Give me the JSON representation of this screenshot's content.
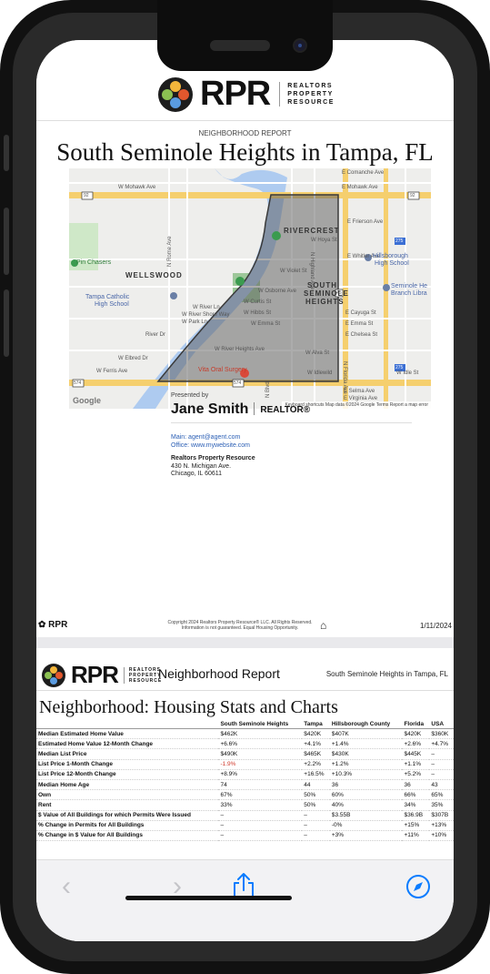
{
  "page1": {
    "logo": {
      "name": "RPR",
      "sub": [
        "REALTORS",
        "PROPERTY",
        "RESOURCE"
      ]
    },
    "report_type": "NEIGHBORHOOD REPORT",
    "title": "South Seminole Heights in Tampa, FL",
    "map": {
      "labels": {
        "mohawk": "W Mohawk Ave",
        "comanche": "E Comanche Ave",
        "emohawk": "E Mohawk Ave",
        "frierson": "E Frierson Ave",
        "hoya": "W Hoya St",
        "whitler": "E Whitler Ave",
        "rivercrest": "RIVERCREST",
        "pin": "Pin Chasers",
        "wellswood": "WELLSWOOD",
        "tampacath1": "Tampa Catholic",
        "tampacath2": "High School",
        "violet": "W Violet St",
        "ssh1": "SOUTH",
        "ssh2": "SEMINOLE",
        "ssh3": "HEIGHTS",
        "hills1": "Hillsborough",
        "hills2": "High School",
        "semlib1": "Seminole He",
        "semlib2": "Branch Libra",
        "osborne": "W Osborne Ave",
        "curtis": "W Curtis St",
        "hibbs": "W Hibbs St",
        "emma": "W Emma St",
        "cayuga": "E Cayuga St",
        "eemma": "E Emma St",
        "chelsea": "E Chelsea St",
        "riverhts": "W River Heights Ave",
        "alva": "W Alva St",
        "idlewild": "W Idlewild",
        "idlest": "W Idle St",
        "elbred": "W Elbred Dr",
        "ferris": "W Ferris Ave",
        "oral": "Vita Oral Surgery",
        "highland": "N Highland Ave",
        "nrome": "N Rome Ave",
        "nblvd": "N Blvd",
        "nflorida": "N Florida Ave",
        "eselma": "E Selma Ave",
        "evirginia": "E Virginia Ave",
        "riverdr": "River Dr",
        "parkln": "W Park Ln",
        "shoreway": "W River Shore Way",
        "riverln": "W River Ln",
        "google": "Google",
        "attribution": "Keyboard shortcuts   Map data ©2024 Google   Terms   Report a map error",
        "shield_92a": "92",
        "shield_92b": "92",
        "shield_275a": "275",
        "shield_275b": "275",
        "shield_574a": "574",
        "shield_574b": "574",
        "shield_45": "45"
      }
    },
    "presented_by": "Presented by",
    "agent_name": "Jane Smith",
    "agent_credential": "REALTOR®",
    "contact_main": "Main: agent@agent.com",
    "contact_office": "Office: www.mywebsite.com",
    "company": "Realtors Property Resource",
    "address1": "430 N. Michigan Ave.",
    "address2": "Chicago, IL 60611",
    "footer": {
      "brand": "RPR",
      "copyright1": "Copyright 2024 Realtors Property Resource® LLC. All Rights Reserved.",
      "copyright2": "Information is not guaranteed. Equal Housing Opportunity.",
      "date": "1/11/2024"
    }
  },
  "page2": {
    "header_title": "Neighborhood Report",
    "location": "South Seminole Heights in Tampa, FL",
    "section_title": "Neighborhood: Housing Stats and Charts",
    "columns": [
      "",
      "South Seminole Heights",
      "Tampa",
      "Hillsborough County",
      "Florida",
      "USA"
    ],
    "rows": [
      [
        "Median Estimated Home Value",
        "$462K",
        "$420K",
        "$407K",
        "$420K",
        "$360K"
      ],
      [
        "Estimated Home Value 12-Month Change",
        "+6.6%",
        "+4.1%",
        "+1.4%",
        "+2.6%",
        "+4.7%"
      ],
      [
        "Median List Price",
        "$490K",
        "$465K",
        "$430K",
        "$445K",
        "–"
      ],
      [
        "List Price 1-Month Change",
        "-1.9%",
        "+2.2%",
        "+1.2%",
        "+1.1%",
        "–"
      ],
      [
        "List Price 12-Month Change",
        "+8.9%",
        "+16.5%",
        "+10.3%",
        "+5.2%",
        "–"
      ],
      [
        "Median Home Age",
        "74",
        "44",
        "36",
        "36",
        "43"
      ],
      [
        "Own",
        "67%",
        "50%",
        "60%",
        "66%",
        "65%"
      ],
      [
        "Rent",
        "33%",
        "50%",
        "40%",
        "34%",
        "35%"
      ],
      [
        "$ Value of All Buildings for which Permits Were Issued",
        "–",
        "–",
        "$3.55B",
        "$36.9B",
        "$307B"
      ],
      [
        "% Change in Permits for All Buildings",
        "–",
        "–",
        "-0%",
        "+15%",
        "+13%"
      ],
      [
        "% Change in $ Value for All Buildings",
        "–",
        "–",
        "+3%",
        "+11%",
        "+10%"
      ]
    ]
  },
  "toolbar": {
    "back_glyph": "‹",
    "forward_glyph": "›"
  },
  "colors": {
    "accent": "#0a7cff",
    "negative": "#d0392b",
    "link": "#2b5fb5",
    "boundary": "#3a3a3a"
  },
  "icons": [
    "back-icon",
    "forward-icon",
    "share-icon",
    "compass-icon",
    "equal-housing-icon",
    "rpr-logo-icon"
  ]
}
